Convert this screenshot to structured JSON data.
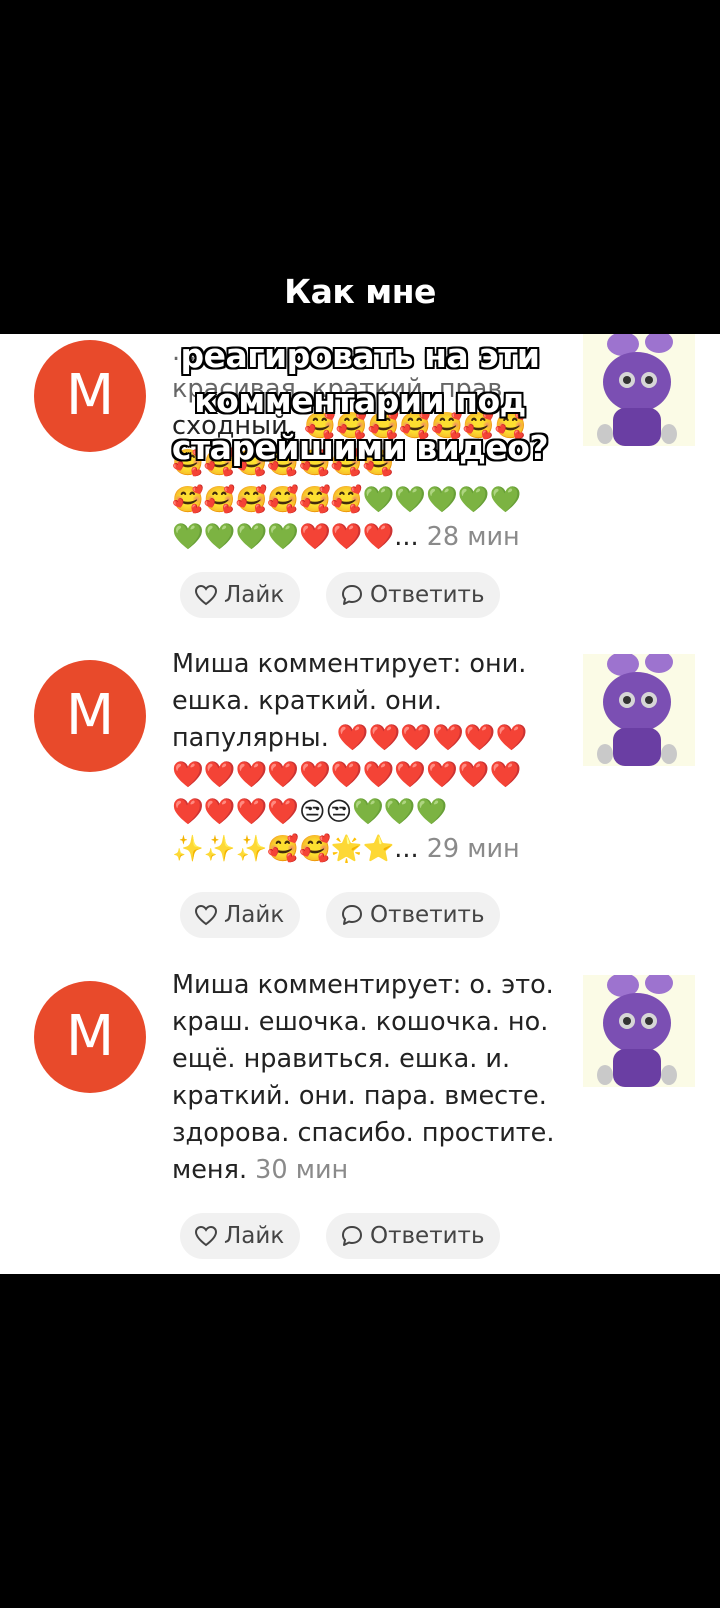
{
  "overlay": {
    "line1": "Как мне",
    "line2": "реагировать на эти",
    "line3": "комментарии под",
    "line4": "старейшими видео?"
  },
  "comments": [
    {
      "avatar_letter": "М",
      "text_partial_1": "...",
      "text_partial_2": "красивая. краткий. прав",
      "text_partial_3": "сходный.",
      "emoji_line_1": "🥰🥰🥰🥰🥰🥰🥰",
      "emoji_line_2": "🥰🥰🥰🥰🥰🥰🥰",
      "emoji_line_3": "🥰🥰🥰🥰🥰🥰💚💚💚💚💚",
      "emoji_line_4": "💚💚💚💚❤️❤️❤️...",
      "time": "28 мин",
      "like_label": "Лайк",
      "reply_label": "Ответить"
    },
    {
      "avatar_letter": "М",
      "text_line_1": "Миша комментирует: они.",
      "text_line_2": "ешка. краткий. они.",
      "text_line_3": "папулярны.",
      "emoji_line_1": "❤️❤️❤️❤️❤️❤️",
      "emoji_line_2": "❤️❤️❤️❤️❤️❤️❤️❤️❤️❤️❤️",
      "emoji_line_3": "❤️❤️❤️❤️😒😒💚💚💚",
      "emoji_line_4": "✨✨✨🥰🥰🌟⭐...",
      "time": "29 мин",
      "like_label": "Лайк",
      "reply_label": "Ответить"
    },
    {
      "avatar_letter": "М",
      "text_line_1": "Миша комментирует: о. это.",
      "text_line_2": "краш. ешочка. кошочка. но.",
      "text_line_3": "ещё. нравиться. ешка. и.",
      "text_line_4": "краткий. они. пара. вместе.",
      "text_line_5": "здорова. спасибо. простите.",
      "text_line_6": "меня.",
      "time": "30 мин",
      "like_label": "Лайк",
      "reply_label": "Ответить"
    }
  ],
  "icons": {
    "like": "heart-outline-icon",
    "reply": "speech-bubble-icon"
  },
  "colors": {
    "avatar": "#e84a2b",
    "thumb_bg": "#fbfbe6",
    "character": "#7b4fb3"
  }
}
